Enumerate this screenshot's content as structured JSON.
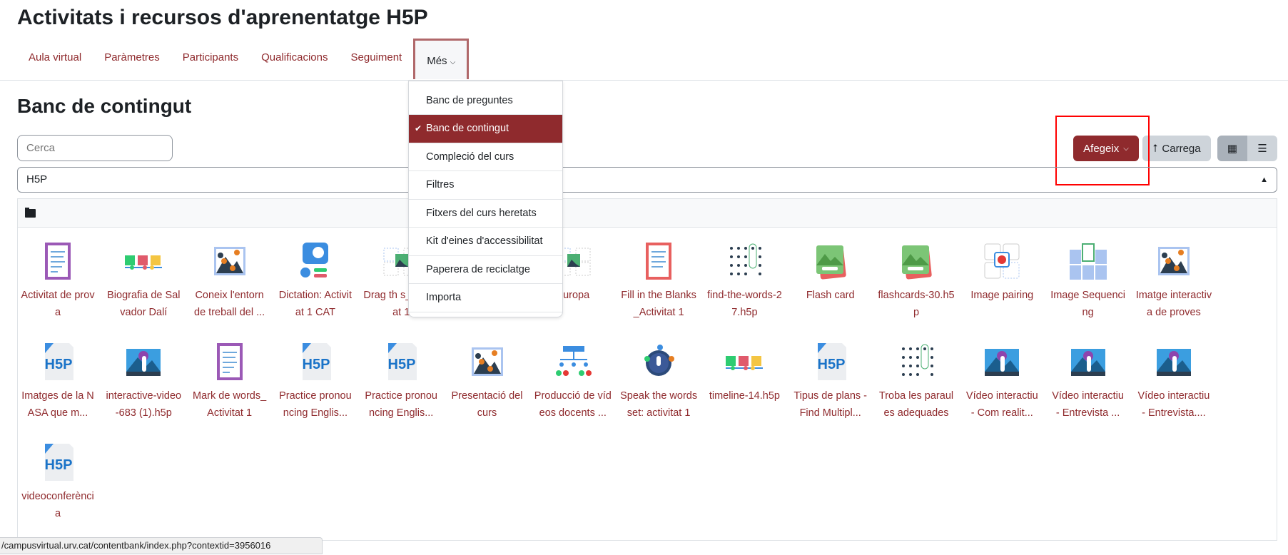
{
  "page_title": "Activitats i recursos d'aprenentatge H5P",
  "nav": [
    {
      "label": "Aula virtual"
    },
    {
      "label": "Paràmetres"
    },
    {
      "label": "Participants"
    },
    {
      "label": "Qualificacions"
    },
    {
      "label": "Seguiment"
    },
    {
      "label": "Més",
      "active": true
    }
  ],
  "more_menu": [
    {
      "label": "Banc de preguntes"
    },
    {
      "label": "Banc de contingut",
      "selected": true
    },
    {
      "label": "Compleció del curs"
    },
    {
      "label": "Filtres"
    },
    {
      "label": "Fitxers del curs heretats"
    },
    {
      "label": "Kit d'eines d'accessibilitat"
    },
    {
      "label": "Paperera de reciclatge"
    },
    {
      "label": "Importa"
    }
  ],
  "section_title": "Banc de contingut",
  "search": {
    "placeholder": "Cerca"
  },
  "filter": {
    "value": "H5P"
  },
  "toolbar": {
    "add_label": "Afegeix",
    "upload_label": "Carrega"
  },
  "colors": {
    "accent": "#8f2a2d",
    "highlight_box": "#ff0000"
  },
  "items": [
    {
      "label": "Activitat de prova",
      "icon": "doc-purple"
    },
    {
      "label": "Biografia de Salvador Dalí",
      "icon": "timeline"
    },
    {
      "label": "Coneix l'entorn de treball del ...",
      "icon": "hotspot"
    },
    {
      "label": "Dictation: Activitat 1 CAT",
      "icon": "dictation"
    },
    {
      "label": "Drag th s_Activitat 1",
      "icon": "drag"
    },
    {
      "label": "",
      "icon": "drag"
    },
    {
      "label": "Europa",
      "icon": "drag"
    },
    {
      "label": "Fill in the Blanks_Activitat 1",
      "icon": "doc-red"
    },
    {
      "label": "find-the-words-27.h5p",
      "icon": "findwords"
    },
    {
      "label": "Flash card",
      "icon": "flashcard"
    },
    {
      "label": "flashcards-30.h5p",
      "icon": "flashcard"
    },
    {
      "label": "Image pairing",
      "icon": "pairing"
    },
    {
      "label": "Image Sequencing",
      "icon": "sequence"
    },
    {
      "label": "Imatge interactiva de proves",
      "icon": "hotspot"
    },
    {
      "label": "Imatges de la NASA que m...",
      "icon": "h5p"
    },
    {
      "label": "interactive-video-683 (1).h5p",
      "icon": "video"
    },
    {
      "label": "Mark de words_Activitat 1",
      "icon": "doc-purple"
    },
    {
      "label": "Practice pronouncing Englis...",
      "icon": "h5p"
    },
    {
      "label": "Practice pronouncing Englis...",
      "icon": "h5p"
    },
    {
      "label": "Presentació del curs",
      "icon": "hotspot"
    },
    {
      "label": "Producció de vídeos docents ...",
      "icon": "tree"
    },
    {
      "label": "Speak the words set: activitat 1",
      "icon": "speak"
    },
    {
      "label": "timeline-14.h5p",
      "icon": "timeline"
    },
    {
      "label": "Tipus de plans - Find Multipl...",
      "icon": "h5p"
    },
    {
      "label": "Troba les paraules adequades",
      "icon": "findwords"
    },
    {
      "label": "Vídeo interactiu - Com realit...",
      "icon": "video"
    },
    {
      "label": "Vídeo interactiu - Entrevista ...",
      "icon": "video"
    },
    {
      "label": "Vídeo interactiu - Entrevista....",
      "icon": "video"
    },
    {
      "label": "videoconferència",
      "icon": "h5p"
    }
  ],
  "status_url": "/campusvirtual.urv.cat/contentbank/index.php?contextid=3956016"
}
